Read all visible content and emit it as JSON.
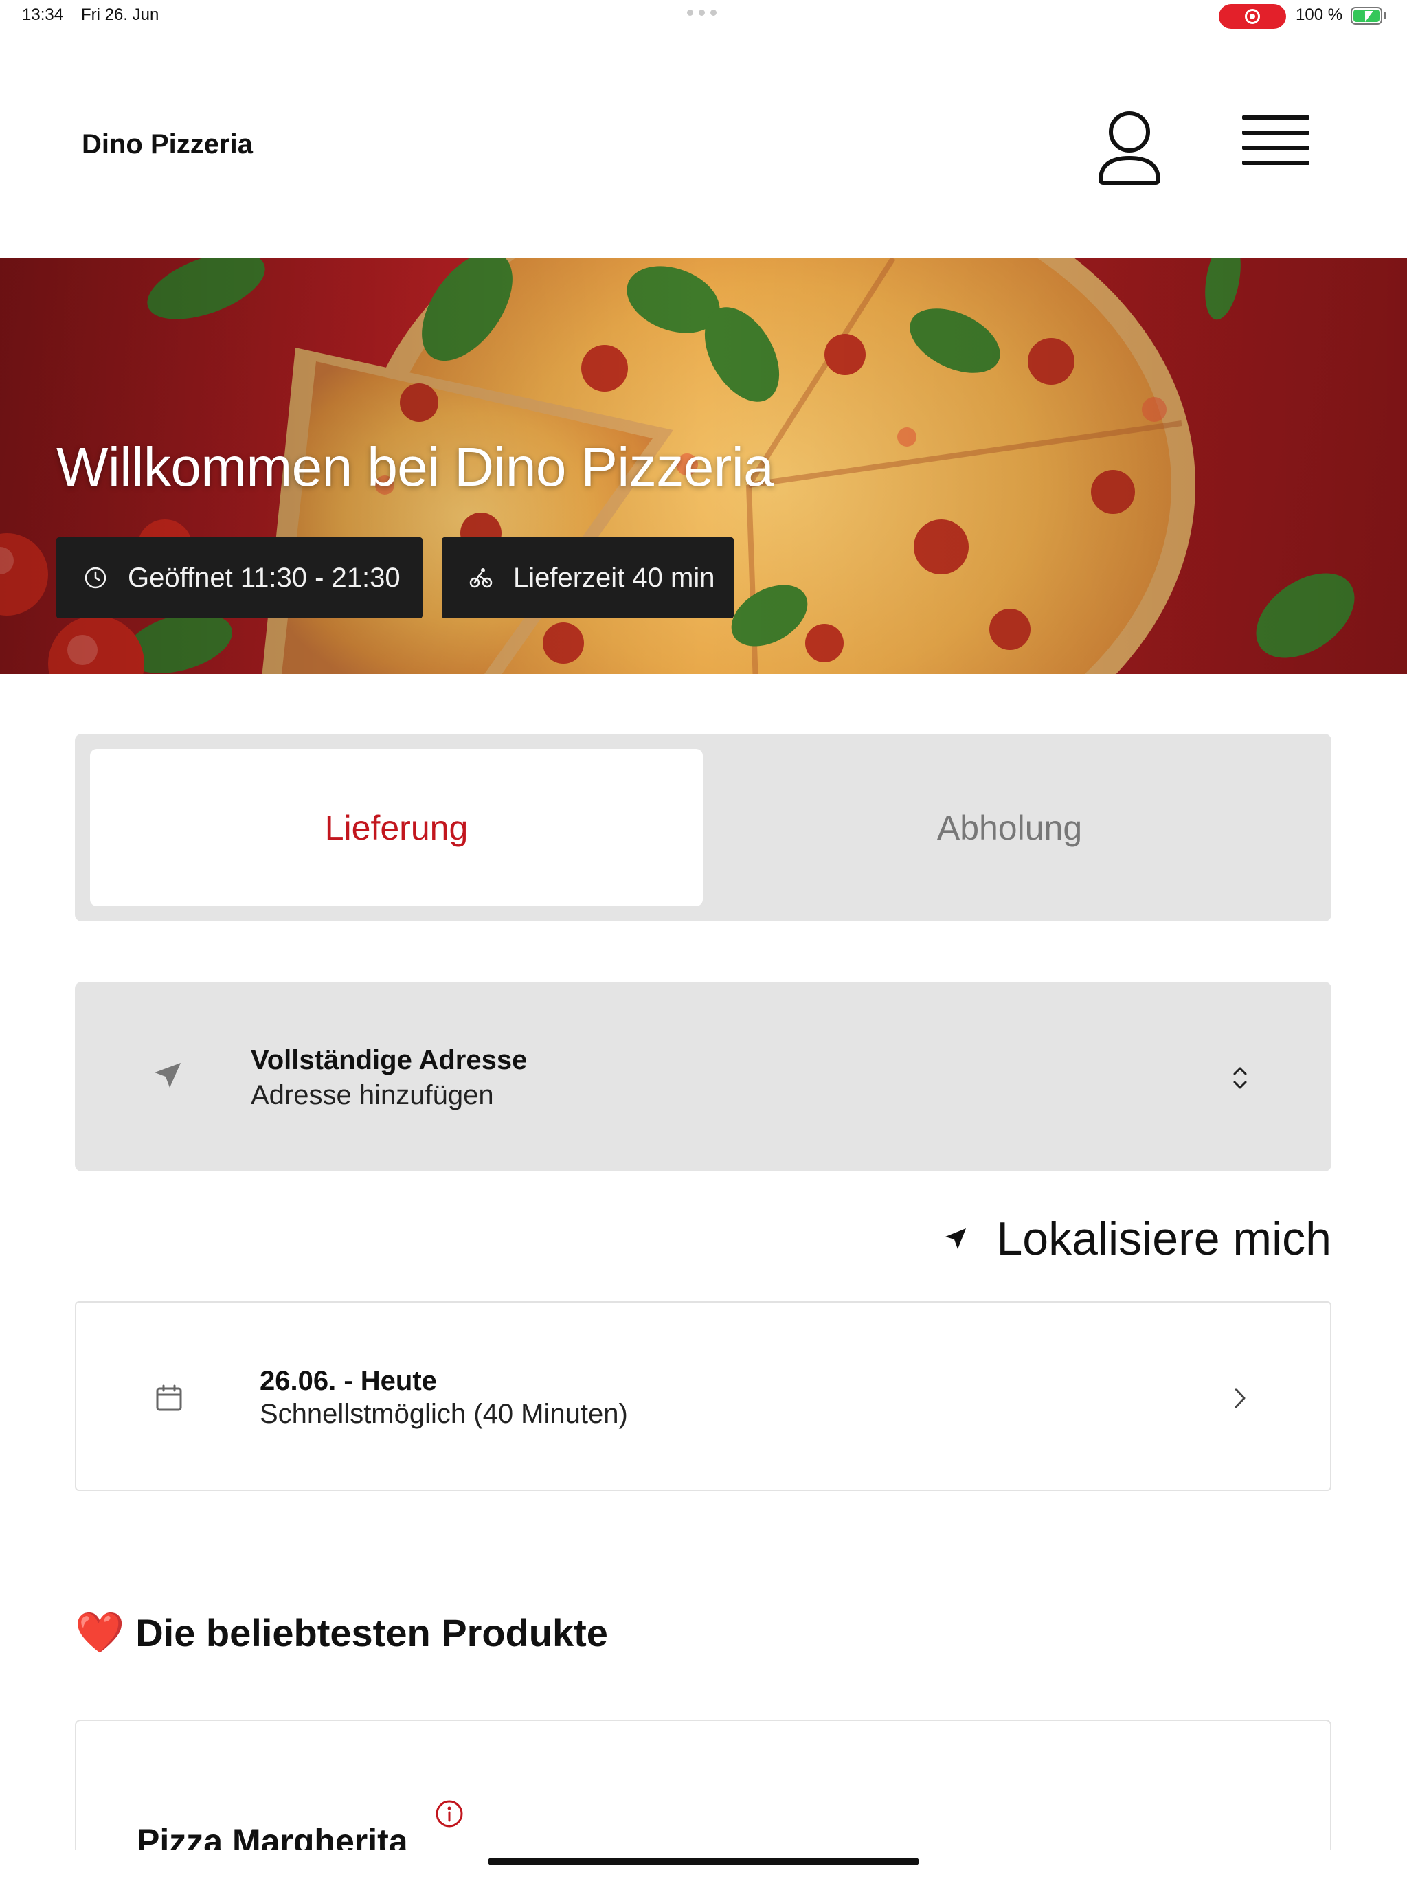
{
  "status_bar": {
    "time": "13:34",
    "date": "Fri 26. Jun",
    "battery": "100 %",
    "recording_color": "#e3202a",
    "battery_color": "#34c759"
  },
  "header": {
    "brand": "Dino Pizzeria",
    "user_icon": "user-icon",
    "menu_icon": "hamburger-menu-icon"
  },
  "hero": {
    "title": "Willkommen bei Dino Pizzeria",
    "opening_hours": "Geöffnet 11:30 - 21:30",
    "delivery_time": "Lieferzeit 40 min",
    "opening_icon": "clock-icon",
    "delivery_icon": "bicycle-icon"
  },
  "order_mode": {
    "active": "Lieferung",
    "inactive": "Abholung",
    "accent_color": "#c2161e"
  },
  "address": {
    "title": "Vollständige Adresse",
    "subtitle": "Adresse hinzufügen",
    "icon": "location-arrow-icon",
    "chevron_icon": "chevron-up-down-icon"
  },
  "locate": {
    "label": "Lokalisiere mich",
    "icon": "location-arrow-icon"
  },
  "delivery_date": {
    "title": "26.06. - Heute",
    "subtitle": "Schnellstmöglich (40 Minuten)",
    "icon": "calendar-icon",
    "chevron_icon": "chevron-right-icon"
  },
  "popular": {
    "heart": "❤️",
    "title": "Die beliebtesten Produkte"
  },
  "products": [
    {
      "name": "Pizza Margherita",
      "info_icon": "info-icon"
    }
  ]
}
